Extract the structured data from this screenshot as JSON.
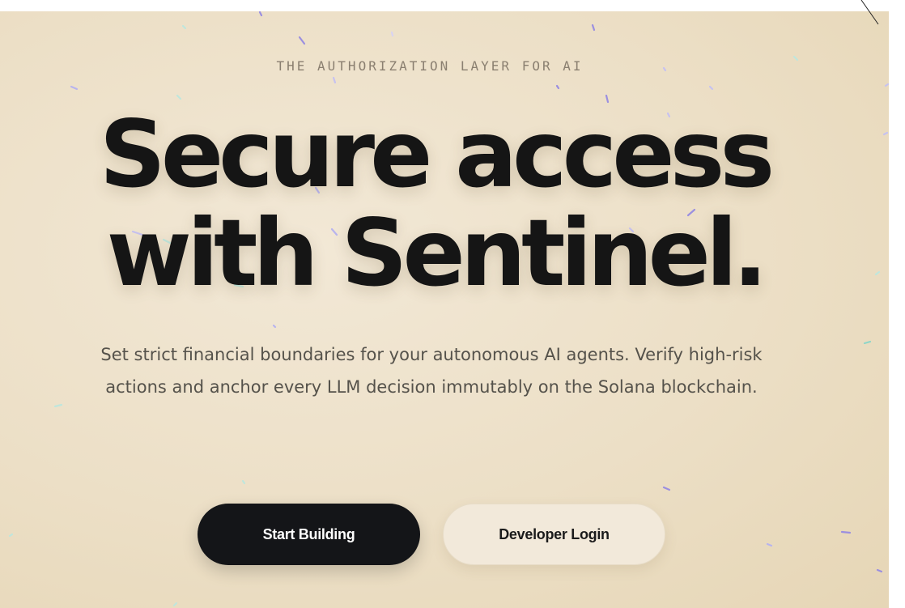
{
  "hero": {
    "eyebrow": "THE AUTHORIZATION LAYER FOR AI",
    "headline_line1": "Secure access",
    "headline_line2": "with Sentinel.",
    "subtitle": "Set strict financial boundaries for your autonomous AI agents. Verify high-risk actions and anchor every LLM decision immutably on the Solana blockchain."
  },
  "buttons": {
    "primary_label": "Start Building",
    "secondary_label": "Developer Login"
  },
  "colors": {
    "background": "#ecdfc6",
    "headline": "#151515",
    "primary_button": "#141518",
    "secondary_button": "#f2e9da",
    "particle_purple": "#9b8fe0",
    "particle_teal": "#8fd6c8"
  }
}
